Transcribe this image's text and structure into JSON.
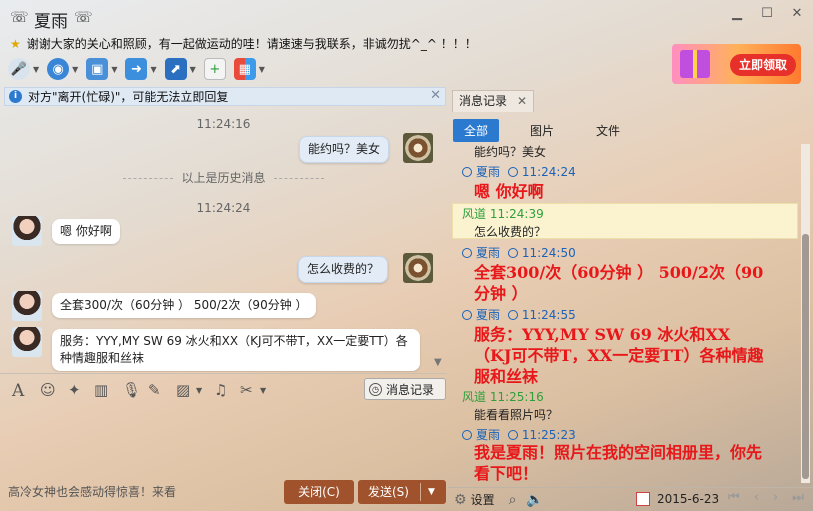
{
  "window": {
    "contact_name": "夏雨",
    "signature": "谢谢大家的关心和照顾，有一起做运动的哇！请速速与我联系，非诚勿扰^_^ ！！！",
    "controls": [
      "minimize",
      "maximize",
      "close"
    ]
  },
  "toolbar": {
    "items": [
      "voice-call-icon",
      "video-call-icon",
      "remote-desktop-icon",
      "file-transfer-icon",
      "screen-share-icon",
      "new-group-chat-icon",
      "apps-icon"
    ]
  },
  "ad": {
    "button_label": "立即领取"
  },
  "notice": {
    "text": "对方\"离开(忙碌)\"，可能无法立即回复"
  },
  "chat": {
    "messages": [
      {
        "type": "timestamp",
        "text": "11:24:16"
      },
      {
        "type": "me",
        "text": "能约吗？美女"
      },
      {
        "type": "divider",
        "text": "以上是历史消息"
      },
      {
        "type": "timestamp",
        "text": "11:24:24"
      },
      {
        "type": "other",
        "text": "嗯 你好啊"
      },
      {
        "type": "me",
        "text": "怎么收费的？"
      },
      {
        "type": "other",
        "text": "全套300/次（60分钟 ） 500/2次（90分钟 ）"
      },
      {
        "type": "other",
        "text": "服务：YYY,MY SW 69 冰火和XX（KJ可不带T，XX一定要TT）各种情趣服和丝袜"
      }
    ]
  },
  "input_toolbar": {
    "history_button": "消息记录"
  },
  "bottom": {
    "hint": "高冷女神也会感动得惊喜！来看",
    "close_button": "关闭(C)",
    "send_button": "发送(S)"
  },
  "history_panel": {
    "tab_label": "消息记录",
    "filters": [
      "全部",
      "图片",
      "文件"
    ],
    "active_filter": "全部",
    "entries": [
      {
        "kind": "plain",
        "text": "能约吗？美女"
      },
      {
        "kind": "head",
        "who": "夏雨",
        "time": "11:24:24",
        "color": "#1b62b8"
      },
      {
        "kind": "red",
        "text": "嗯 你好啊"
      },
      {
        "kind": "head",
        "who": "风道",
        "time": "11:24:39",
        "color": "#2e9f3c"
      },
      {
        "kind": "plain",
        "text": "怎么收费的？"
      },
      {
        "kind": "head",
        "who": "夏雨",
        "time": "11:24:50",
        "color": "#1b62b8"
      },
      {
        "kind": "red",
        "text": "全套300/次（60分钟 ） 500/2次（90分钟 ）"
      },
      {
        "kind": "head",
        "who": "夏雨",
        "time": "11:24:55",
        "color": "#1b62b8"
      },
      {
        "kind": "red",
        "text": "服务：YYY,MY SW 69 冰火和XX（KJ可不带T，XX一定要TT）各种情趣服和丝袜"
      },
      {
        "kind": "head",
        "who": "风道",
        "time": "11:25:16",
        "color": "#2e9f3c"
      },
      {
        "kind": "plain",
        "text": "能看看照片吗？"
      },
      {
        "kind": "head",
        "who": "夏雨",
        "time": "11:25:23",
        "color": "#1b62b8"
      },
      {
        "kind": "red",
        "text": "我是夏雨！照片在我的空间相册里，你先看下吧！"
      }
    ],
    "footer": {
      "settings_label": "设置",
      "date": "2015-6-23"
    }
  }
}
